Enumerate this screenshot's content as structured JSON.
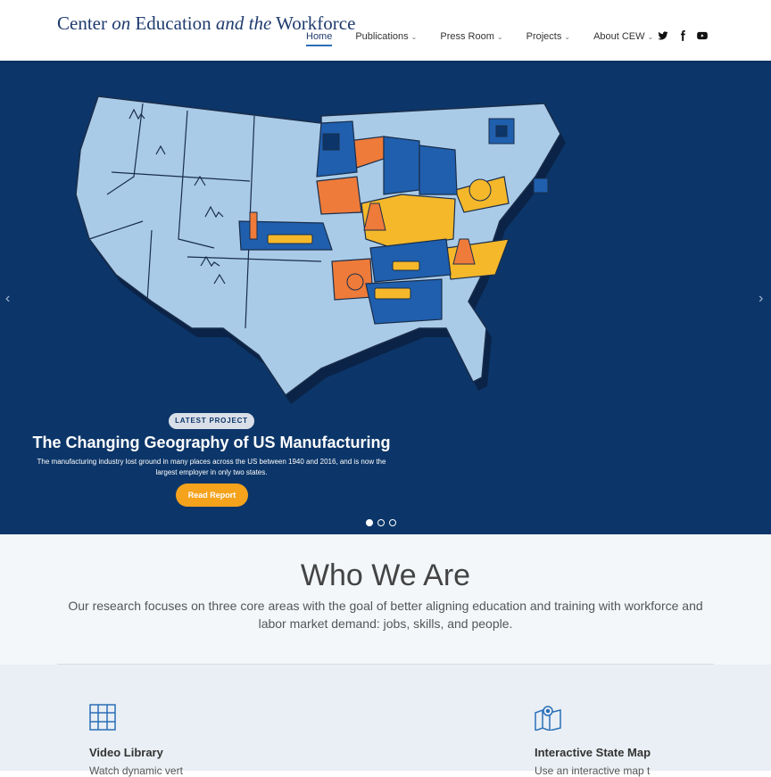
{
  "header": {
    "logo": {
      "part1": "Center ",
      "part2": "on",
      "part3": " Education ",
      "part4": "and the",
      "part5": " Workforce"
    },
    "nav": [
      {
        "label": "Home",
        "dropdown": false
      },
      {
        "label": "Publications",
        "dropdown": true
      },
      {
        "label": "Press Room",
        "dropdown": true
      },
      {
        "label": "Projects",
        "dropdown": true
      },
      {
        "label": "About CEW",
        "dropdown": true
      }
    ],
    "social": [
      "twitter-icon",
      "facebook-icon",
      "youtube-icon"
    ]
  },
  "hero": {
    "badge": "LATEST PROJECT",
    "title": "The Changing Geography of US Manufacturing",
    "description": "The manufacturing industry lost ground in many places across the US between 1940 and 2016, and is now the largest employer in only two states.",
    "button": "Read Report",
    "arrow_left": "‹",
    "arrow_right": "›",
    "slide_count": 3,
    "active_slide": 1
  },
  "who": {
    "title": "Who We Are",
    "text": "Our research focuses on three core areas with the goal of better aligning education and training with workforce and labor market demand: jobs, skills, and people."
  },
  "cards": [
    {
      "title": "Video Library",
      "subtitle": "Watch dynamic vert",
      "icon": "video-grid-icon"
    },
    {
      "title": "Interactive State Map",
      "subtitle": "Use an interactive map t",
      "icon": "map-pin-icon"
    }
  ],
  "colors": {
    "navy": "#0c3669",
    "accent": "#f5a21c",
    "map_light": "#a9cbe8",
    "map_orange": "#ee7b3a",
    "map_yellow": "#f5b82a",
    "map_blue": "#1f5fae"
  }
}
